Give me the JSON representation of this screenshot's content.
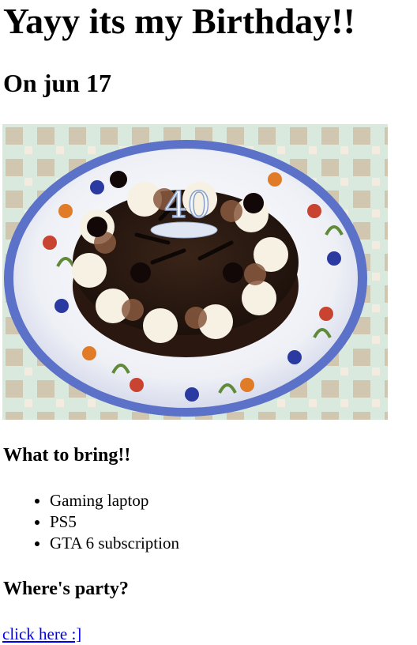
{
  "page": {
    "title": "Yayy its my Birthday!!",
    "date": "On jun 17"
  },
  "image": {
    "subject": "birthday-cake",
    "cake_topper_number": "40"
  },
  "bring": {
    "heading": "What to bring!!",
    "items": [
      "Gaming laptop",
      "PS5",
      "GTA 6 subscription"
    ]
  },
  "party": {
    "heading": "Where's party?",
    "link_text": "click here :]"
  },
  "colors": {
    "link": "#0000ee",
    "text": "#000000",
    "background": "#ffffff"
  }
}
